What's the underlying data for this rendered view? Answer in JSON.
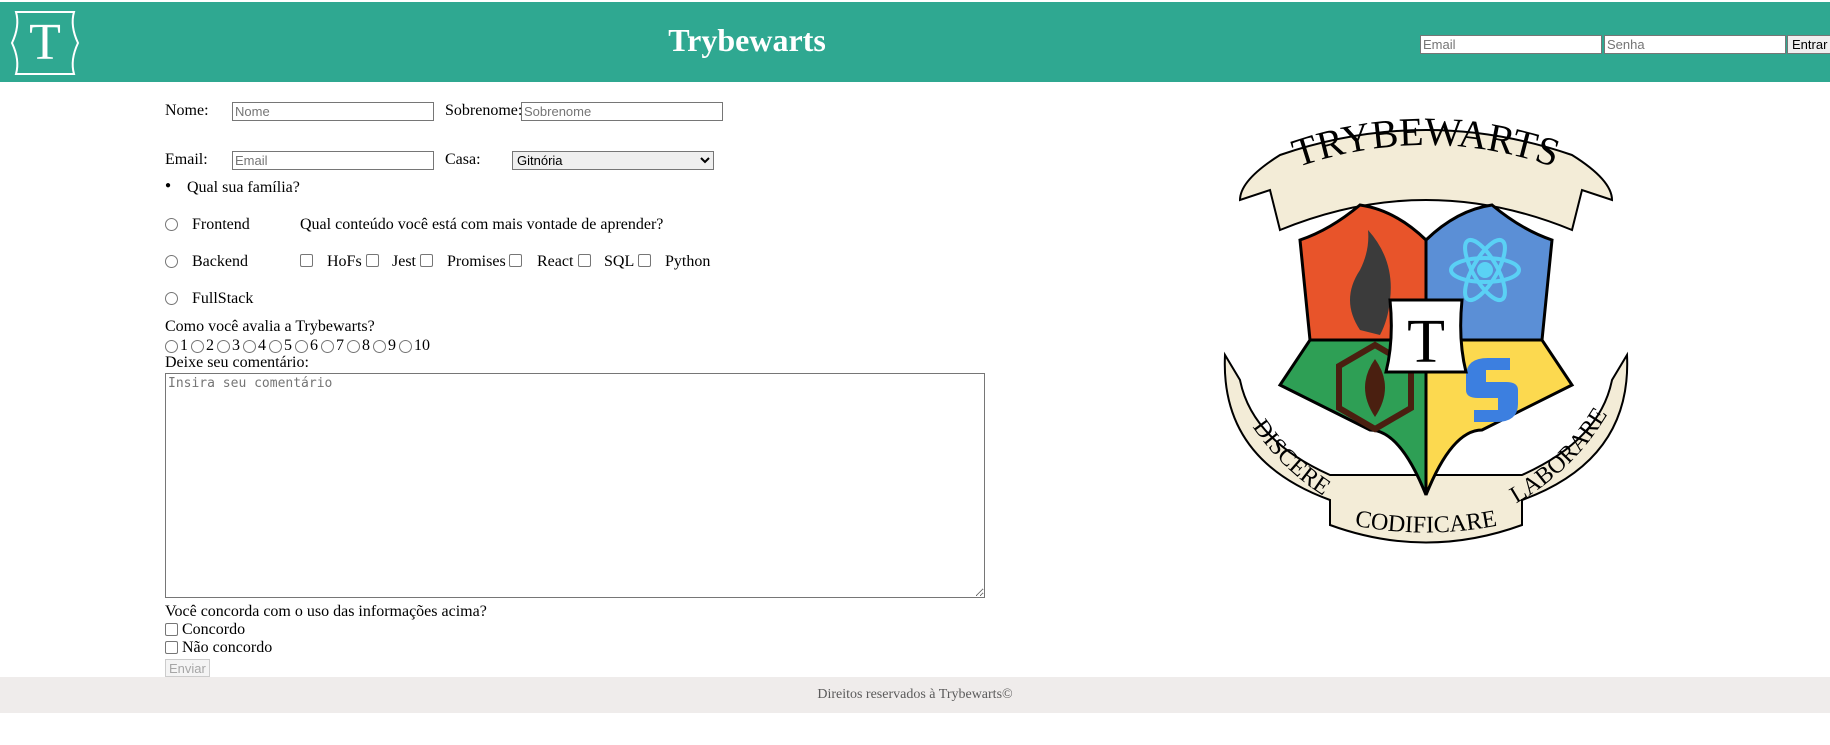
{
  "header": {
    "logo_letter": "T",
    "title": "Trybewarts",
    "login": {
      "email_placeholder": "Email",
      "password_placeholder": "Senha",
      "button_label": "Entrar"
    }
  },
  "form": {
    "name_label": "Nome:",
    "name_placeholder": "Nome",
    "lastname_label": "Sobrenome:",
    "lastname_placeholder": "Sobrenome",
    "email_label": "Email:",
    "email_placeholder": "Email",
    "house_label": "Casa:",
    "house_selected": "Gitnória",
    "family_question": "Qual sua família?",
    "families": [
      "Frontend",
      "Backend",
      "FullStack"
    ],
    "content_question": "Qual conteúdo você está com mais vontade de aprender?",
    "contents": [
      "HoFs",
      "Jest",
      "Promises",
      "React",
      "SQL",
      "Python"
    ],
    "rating_question": "Como você avalia a Trybewarts?",
    "ratings": [
      "1",
      "2",
      "3",
      "4",
      "5",
      "6",
      "7",
      "8",
      "9",
      "10"
    ],
    "comment_label": "Deixe seu comentário:",
    "comment_placeholder": "Insira seu comentário",
    "agreement_question": "Você concorda com o uso das informações acima?",
    "agree_label": "Concordo",
    "disagree_label": "Não concordo",
    "submit_label": "Enviar"
  },
  "crest": {
    "banner_top": "TRYBEWARTS",
    "motto_left": "DISCERE",
    "motto_center": "CODIFICARE",
    "motto_right": "LABORARE",
    "center_letter": "T"
  },
  "footer": {
    "text": "Direitos reservados à Trybewarts©"
  },
  "colors": {
    "header": "#2fa891",
    "footer_bg": "#efeceb",
    "crest_red": "#e8542a",
    "crest_blue": "#5b8fd6",
    "crest_green": "#2e9f55",
    "crest_yellow": "#fcd94f"
  }
}
